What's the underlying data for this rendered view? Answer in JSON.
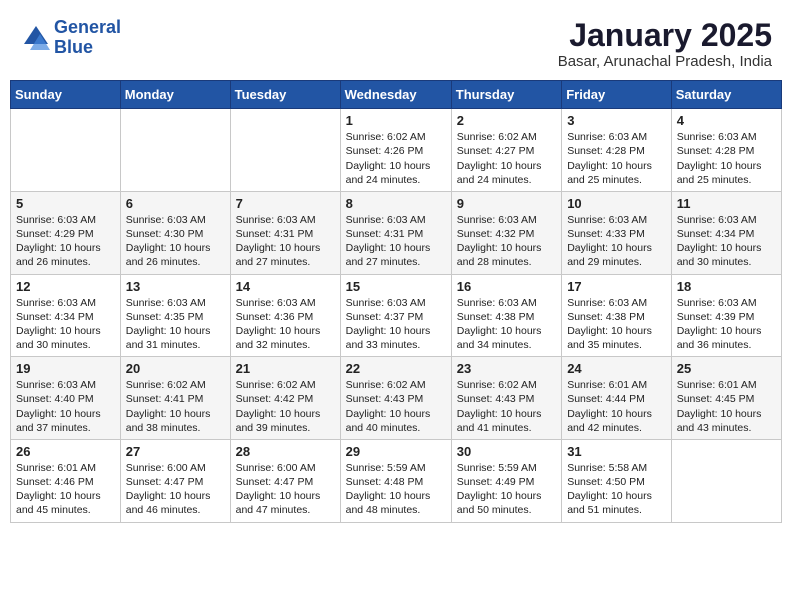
{
  "header": {
    "logo_line1": "General",
    "logo_line2": "Blue",
    "month_title": "January 2025",
    "location": "Basar, Arunachal Pradesh, India"
  },
  "weekdays": [
    "Sunday",
    "Monday",
    "Tuesday",
    "Wednesday",
    "Thursday",
    "Friday",
    "Saturday"
  ],
  "weeks": [
    [
      {
        "day": "",
        "info": ""
      },
      {
        "day": "",
        "info": ""
      },
      {
        "day": "",
        "info": ""
      },
      {
        "day": "1",
        "info": "Sunrise: 6:02 AM\nSunset: 4:26 PM\nDaylight: 10 hours\nand 24 minutes."
      },
      {
        "day": "2",
        "info": "Sunrise: 6:02 AM\nSunset: 4:27 PM\nDaylight: 10 hours\nand 24 minutes."
      },
      {
        "day": "3",
        "info": "Sunrise: 6:03 AM\nSunset: 4:28 PM\nDaylight: 10 hours\nand 25 minutes."
      },
      {
        "day": "4",
        "info": "Sunrise: 6:03 AM\nSunset: 4:28 PM\nDaylight: 10 hours\nand 25 minutes."
      }
    ],
    [
      {
        "day": "5",
        "info": "Sunrise: 6:03 AM\nSunset: 4:29 PM\nDaylight: 10 hours\nand 26 minutes."
      },
      {
        "day": "6",
        "info": "Sunrise: 6:03 AM\nSunset: 4:30 PM\nDaylight: 10 hours\nand 26 minutes."
      },
      {
        "day": "7",
        "info": "Sunrise: 6:03 AM\nSunset: 4:31 PM\nDaylight: 10 hours\nand 27 minutes."
      },
      {
        "day": "8",
        "info": "Sunrise: 6:03 AM\nSunset: 4:31 PM\nDaylight: 10 hours\nand 27 minutes."
      },
      {
        "day": "9",
        "info": "Sunrise: 6:03 AM\nSunset: 4:32 PM\nDaylight: 10 hours\nand 28 minutes."
      },
      {
        "day": "10",
        "info": "Sunrise: 6:03 AM\nSunset: 4:33 PM\nDaylight: 10 hours\nand 29 minutes."
      },
      {
        "day": "11",
        "info": "Sunrise: 6:03 AM\nSunset: 4:34 PM\nDaylight: 10 hours\nand 30 minutes."
      }
    ],
    [
      {
        "day": "12",
        "info": "Sunrise: 6:03 AM\nSunset: 4:34 PM\nDaylight: 10 hours\nand 30 minutes."
      },
      {
        "day": "13",
        "info": "Sunrise: 6:03 AM\nSunset: 4:35 PM\nDaylight: 10 hours\nand 31 minutes."
      },
      {
        "day": "14",
        "info": "Sunrise: 6:03 AM\nSunset: 4:36 PM\nDaylight: 10 hours\nand 32 minutes."
      },
      {
        "day": "15",
        "info": "Sunrise: 6:03 AM\nSunset: 4:37 PM\nDaylight: 10 hours\nand 33 minutes."
      },
      {
        "day": "16",
        "info": "Sunrise: 6:03 AM\nSunset: 4:38 PM\nDaylight: 10 hours\nand 34 minutes."
      },
      {
        "day": "17",
        "info": "Sunrise: 6:03 AM\nSunset: 4:38 PM\nDaylight: 10 hours\nand 35 minutes."
      },
      {
        "day": "18",
        "info": "Sunrise: 6:03 AM\nSunset: 4:39 PM\nDaylight: 10 hours\nand 36 minutes."
      }
    ],
    [
      {
        "day": "19",
        "info": "Sunrise: 6:03 AM\nSunset: 4:40 PM\nDaylight: 10 hours\nand 37 minutes."
      },
      {
        "day": "20",
        "info": "Sunrise: 6:02 AM\nSunset: 4:41 PM\nDaylight: 10 hours\nand 38 minutes."
      },
      {
        "day": "21",
        "info": "Sunrise: 6:02 AM\nSunset: 4:42 PM\nDaylight: 10 hours\nand 39 minutes."
      },
      {
        "day": "22",
        "info": "Sunrise: 6:02 AM\nSunset: 4:43 PM\nDaylight: 10 hours\nand 40 minutes."
      },
      {
        "day": "23",
        "info": "Sunrise: 6:02 AM\nSunset: 4:43 PM\nDaylight: 10 hours\nand 41 minutes."
      },
      {
        "day": "24",
        "info": "Sunrise: 6:01 AM\nSunset: 4:44 PM\nDaylight: 10 hours\nand 42 minutes."
      },
      {
        "day": "25",
        "info": "Sunrise: 6:01 AM\nSunset: 4:45 PM\nDaylight: 10 hours\nand 43 minutes."
      }
    ],
    [
      {
        "day": "26",
        "info": "Sunrise: 6:01 AM\nSunset: 4:46 PM\nDaylight: 10 hours\nand 45 minutes."
      },
      {
        "day": "27",
        "info": "Sunrise: 6:00 AM\nSunset: 4:47 PM\nDaylight: 10 hours\nand 46 minutes."
      },
      {
        "day": "28",
        "info": "Sunrise: 6:00 AM\nSunset: 4:47 PM\nDaylight: 10 hours\nand 47 minutes."
      },
      {
        "day": "29",
        "info": "Sunrise: 5:59 AM\nSunset: 4:48 PM\nDaylight: 10 hours\nand 48 minutes."
      },
      {
        "day": "30",
        "info": "Sunrise: 5:59 AM\nSunset: 4:49 PM\nDaylight: 10 hours\nand 50 minutes."
      },
      {
        "day": "31",
        "info": "Sunrise: 5:58 AM\nSunset: 4:50 PM\nDaylight: 10 hours\nand 51 minutes."
      },
      {
        "day": "",
        "info": ""
      }
    ]
  ]
}
